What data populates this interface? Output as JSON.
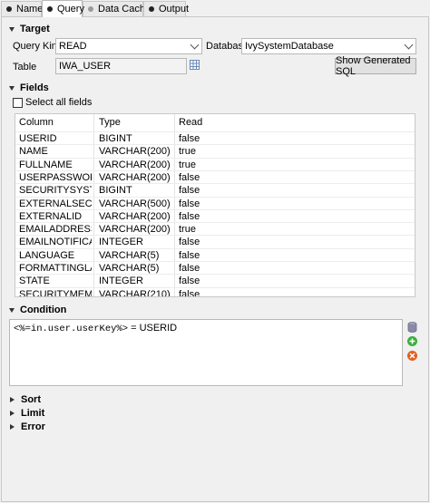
{
  "tabs": [
    {
      "label": "Name",
      "active": false
    },
    {
      "label": "Query",
      "active": true
    },
    {
      "label": "Data Cache",
      "active": false
    },
    {
      "label": "Output",
      "active": false
    }
  ],
  "target": {
    "section_title": "Target",
    "query_kind_label": "Query Kind",
    "query_kind_value": "READ",
    "database_label": "Database",
    "database_value": "IvySystemDatabase",
    "table_label": "Table",
    "table_value": "IWA_USER",
    "show_sql_button": "Show Generated SQL"
  },
  "fields": {
    "section_title": "Fields",
    "select_all_label": "Select all fields",
    "select_all_checked": false,
    "columns": [
      "Column",
      "Type",
      "Read"
    ],
    "rows": [
      [
        "USERID",
        "BIGINT",
        "false"
      ],
      [
        "NAME",
        "VARCHAR(200)",
        "true"
      ],
      [
        "FULLNAME",
        "VARCHAR(200)",
        "true"
      ],
      [
        "USERPASSWORD",
        "VARCHAR(200)",
        "false"
      ],
      [
        "SECURITYSYSTEMID",
        "BIGINT",
        "false"
      ],
      [
        "EXTERNALSECURITYI",
        "VARCHAR(500)",
        "false"
      ],
      [
        "EXTERNALID",
        "VARCHAR(200)",
        "false"
      ],
      [
        "EMAILADDRESS",
        "VARCHAR(200)",
        "true"
      ],
      [
        "EMAILNOTIFICATION",
        "INTEGER",
        "false"
      ],
      [
        "LANGUAGE",
        "VARCHAR(5)",
        "false"
      ],
      [
        "FORMATTINGLANGU",
        "VARCHAR(5)",
        "false"
      ],
      [
        "STATE",
        "INTEGER",
        "false"
      ],
      [
        "SECURITYMEMBERID",
        "VARCHAR(210)",
        "false"
      ]
    ]
  },
  "condition": {
    "section_title": "Condition",
    "code_part": "<%=in.user.userKey%>",
    "text_part": " = USERID"
  },
  "collapsed_sections": [
    "Sort",
    "Limit",
    "Error"
  ],
  "icons": {
    "table_picker": "table-grid-icon",
    "condition_side": [
      "database-icon",
      "add-icon",
      "remove-icon"
    ]
  },
  "colors": {
    "add": "#3cae3c",
    "remove": "#e0601f",
    "database": "#8a8aa8"
  }
}
